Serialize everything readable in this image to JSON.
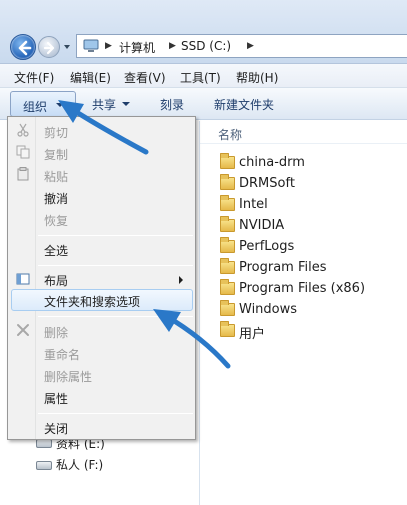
{
  "address_bar": {
    "crumbs": [
      "计算机",
      "SSD (C:)"
    ]
  },
  "menubar": {
    "items": [
      "文件(F)",
      "编辑(E)",
      "查看(V)",
      "工具(T)",
      "帮助(H)"
    ]
  },
  "commandbar": {
    "organize": "组织",
    "share": "共享",
    "burn": "刻录",
    "new_folder": "新建文件夹"
  },
  "content": {
    "column_header": "名称",
    "files": [
      "china-drm",
      "DRMSoft",
      "Intel",
      "NVIDIA",
      "PerfLogs",
      "Program Files",
      "Program Files (x86)",
      "Windows",
      "用户"
    ]
  },
  "organize_menu": {
    "cut": "剪切",
    "copy": "复制",
    "paste": "粘贴",
    "undo": "撤消",
    "redo": "恢复",
    "select_all": "全选",
    "layout": "布局",
    "folder_options": "文件夹和搜索选项",
    "delete": "删除",
    "rename": "重命名",
    "remove_properties": "删除属性",
    "properties": "属性",
    "close": "关闭"
  },
  "navpane": {
    "drives": [
      "资料 (E:)",
      "私人 (F:)"
    ]
  },
  "colors": {
    "annotation_arrow": "#2a78c8",
    "menu_highlight": "#dcebfb"
  }
}
